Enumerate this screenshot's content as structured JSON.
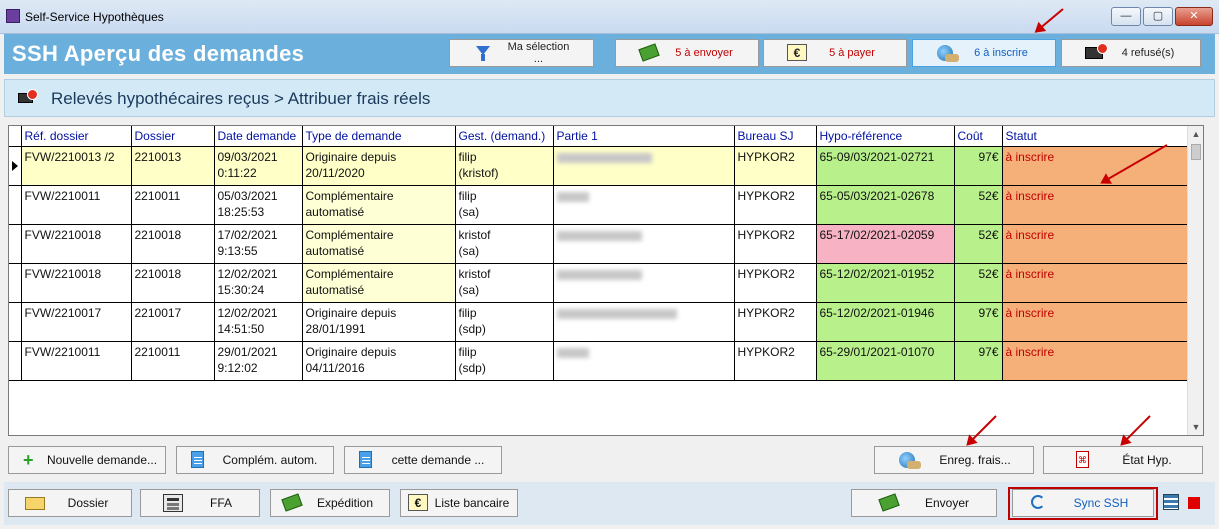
{
  "window": {
    "title": "Self-Service Hypothèques",
    "controls": {
      "minimize": "—",
      "maximize": "▢",
      "close": "✕"
    }
  },
  "header": {
    "title": "SSH  Aperçu des demandes",
    "buttons": {
      "selection": "Ma sélection ...",
      "to_send": "5 à envoyer",
      "to_pay": "5 à payer",
      "to_register": "6 à inscrire",
      "refused": "4 refusé(s)"
    }
  },
  "subheader": {
    "title": "Relevés hypothécaires reçus > Attribuer frais réels"
  },
  "table": {
    "columns": [
      "Réf. dossier",
      "Dossier",
      "Date demande",
      "Type de demande",
      "Gest. (demand.)",
      "Partie 1",
      "Bureau SJ",
      "Hypo-référence",
      "Coût",
      "Statut"
    ],
    "rows": [
      {
        "ref": "FVW/2210013 /2",
        "dossier": "2210013",
        "date": "09/03/2021",
        "time": "0:11:22",
        "type1": "Originaire depuis",
        "type2": "20/11/2020",
        "gest1": "filip",
        "gest2": "(kristof)",
        "bureau": "HYPKOR2",
        "hypo": "65-09/03/2021-02721",
        "cost": "97€",
        "status": "à inscrire"
      },
      {
        "ref": "FVW/2210011",
        "dossier": "2210011",
        "date": "05/03/2021",
        "time": "18:25:53",
        "type1": "Complémentaire",
        "type2": "automatisé",
        "gest1": "filip",
        "gest2": "(sa)",
        "bureau": "HYPKOR2",
        "hypo": "65-05/03/2021-02678",
        "cost": "52€",
        "status": "à inscrire"
      },
      {
        "ref": "FVW/2210018",
        "dossier": "2210018",
        "date": "17/02/2021",
        "time": "9:13:55",
        "type1": "Complémentaire",
        "type2": "automatisé",
        "gest1": "kristof",
        "gest2": "(sa)",
        "bureau": "HYPKOR2",
        "hypo": "65-17/02/2021-02059",
        "cost": "52€",
        "status": "à inscrire"
      },
      {
        "ref": "FVW/2210018",
        "dossier": "2210018",
        "date": "12/02/2021",
        "time": "15:30:24",
        "type1": "Complémentaire",
        "type2": "automatisé",
        "gest1": "kristof",
        "gest2": "(sa)",
        "bureau": "HYPKOR2",
        "hypo": "65-12/02/2021-01952",
        "cost": "52€",
        "status": "à inscrire"
      },
      {
        "ref": "FVW/2210017",
        "dossier": "2210017",
        "date": "12/02/2021",
        "time": "14:51:50",
        "type1": "Originaire depuis",
        "type2": "28/01/1991",
        "gest1": "filip",
        "gest2": "(sdp)",
        "bureau": "HYPKOR2",
        "hypo": "65-12/02/2021-01946",
        "cost": "97€",
        "status": "à inscrire"
      },
      {
        "ref": "FVW/2210011",
        "dossier": "2210011",
        "date": "29/01/2021",
        "time": "9:12:02",
        "type1": "Originaire depuis",
        "type2": "04/11/2016",
        "gest1": "filip",
        "gest2": "(sdp)",
        "bureau": "HYPKOR2",
        "hypo": "65-29/01/2021-01070",
        "cost": "97€",
        "status": "à inscrire"
      }
    ]
  },
  "actions": {
    "new_request": "Nouvelle demande...",
    "complement": "Complém. autom.",
    "this_request": "cette demande ...",
    "register_fees": "Enreg. frais...",
    "state_hyp": "État Hyp."
  },
  "footer": {
    "dossier": "Dossier",
    "ffa": "FFA",
    "shipping": "Expédition",
    "bank_list": "Liste bancaire",
    "send": "Envoyer",
    "sync": "Sync SSH"
  },
  "colors": {
    "header": "#6bb0dc",
    "status": "#f5b07a",
    "ref_ok": "#b8f08c",
    "ref_warn": "#f7b3c3",
    "highlight": "#c00000"
  }
}
